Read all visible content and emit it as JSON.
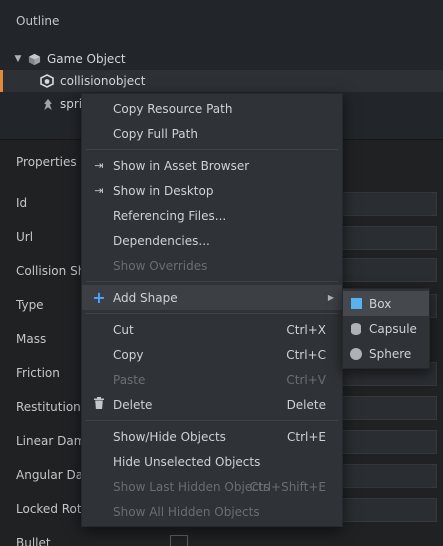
{
  "outline": {
    "title": "Outline",
    "tree": {
      "root_label": "Game Object",
      "children": [
        {
          "label": "collisionobject",
          "selected": true
        },
        {
          "label": "spri"
        }
      ]
    }
  },
  "properties": {
    "title": "Properties",
    "labels": [
      "Id",
      "Url",
      "Collision Sha",
      "Type",
      "Mass",
      "Friction",
      "Restitution",
      "Linear Damp",
      "Angular Dan",
      "Locked Rota",
      "Bullet"
    ]
  },
  "context_menu": {
    "items": [
      {
        "label": "Copy Resource Path"
      },
      {
        "label": "Copy Full Path"
      },
      {
        "label": "Show in Asset Browser",
        "icon": "reveal-icon"
      },
      {
        "label": "Show in Desktop",
        "icon": "reveal-icon"
      },
      {
        "label": "Referencing Files..."
      },
      {
        "label": "Dependencies..."
      },
      {
        "label": "Show Overrides",
        "disabled": true
      },
      {
        "label": "Add Shape",
        "icon": "plus-icon",
        "submenu": true
      },
      {
        "label": "Cut",
        "shortcut": "Ctrl+X"
      },
      {
        "label": "Copy",
        "shortcut": "Ctrl+C"
      },
      {
        "label": "Paste",
        "shortcut": "Ctrl+V",
        "disabled": true
      },
      {
        "label": "Delete",
        "shortcut": "Delete",
        "icon": "trash-icon"
      },
      {
        "label": "Show/Hide Objects",
        "shortcut": "Ctrl+E"
      },
      {
        "label": "Hide Unselected Objects"
      },
      {
        "label": "Show Last Hidden Objects",
        "shortcut": "Ctrl+Shift+E",
        "disabled": true
      },
      {
        "label": "Show All Hidden Objects",
        "disabled": true
      }
    ]
  },
  "submenu": {
    "items": [
      {
        "label": "Box",
        "icon": "box-shape-icon"
      },
      {
        "label": "Capsule",
        "icon": "capsule-shape-icon"
      },
      {
        "label": "Sphere",
        "icon": "sphere-shape-icon"
      }
    ]
  },
  "colors": {
    "selection_accent": "#e08a3a",
    "add_icon": "#4da3ff",
    "box_icon": "#58b2f0"
  }
}
